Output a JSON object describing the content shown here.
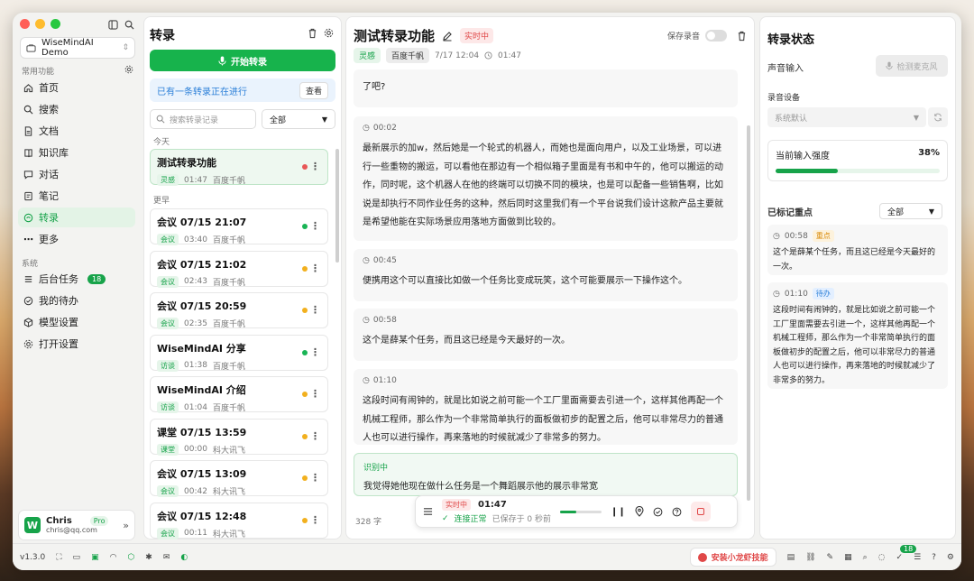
{
  "sidebar": {
    "workspace": "WiseMindAI Demo",
    "section_common": "常用功能",
    "items": [
      {
        "label": "首页",
        "icon": "home-icon"
      },
      {
        "label": "搜索",
        "icon": "search-icon"
      },
      {
        "label": "文档",
        "icon": "document-icon"
      },
      {
        "label": "知识库",
        "icon": "book-icon"
      },
      {
        "label": "对话",
        "icon": "chat-icon"
      },
      {
        "label": "笔记",
        "icon": "note-icon"
      },
      {
        "label": "转录",
        "icon": "transcribe-icon",
        "active": true
      },
      {
        "label": "更多",
        "icon": "more-icon"
      }
    ],
    "section_system": "系统",
    "system_items": [
      {
        "label": "后台任务",
        "badge": "18"
      },
      {
        "label": "我的待办"
      },
      {
        "label": "模型设置"
      },
      {
        "label": "打开设置"
      }
    ],
    "user": {
      "name": "Chris",
      "email": "chris@qq.com",
      "plan": "Pro",
      "initial": "W"
    }
  },
  "list": {
    "title": "转录",
    "start_label": "开始转录",
    "notice": "已有一条转录正在进行",
    "view_label": "查看",
    "search_placeholder": "搜索转录记录",
    "filter": "全部",
    "group_today": "今天",
    "group_earlier": "更早",
    "today": [
      {
        "title": "测试转录功能",
        "tag": "灵感",
        "duration": "01:47",
        "engine": "百度千帆",
        "status_color": "#e85757"
      }
    ],
    "earlier": [
      {
        "title": "会议 07/15 21:07",
        "tag": "会议",
        "duration": "03:40",
        "engine": "百度千帆",
        "status_color": "#19b455"
      },
      {
        "title": "会议 07/15 21:02",
        "tag": "会议",
        "duration": "02:43",
        "engine": "百度千帆",
        "status_color": "#f2b01e"
      },
      {
        "title": "会议 07/15 20:59",
        "tag": "会议",
        "duration": "02:35",
        "engine": "百度千帆",
        "status_color": "#f2b01e"
      },
      {
        "title": "WiseMindAI 分享",
        "tag": "访谈",
        "duration": "01:38",
        "engine": "百度千帆",
        "status_color": "#19b455"
      },
      {
        "title": "WiseMindAI 介绍",
        "tag": "访谈",
        "duration": "01:04",
        "engine": "百度千帆",
        "status_color": "#f2b01e"
      },
      {
        "title": "课堂 07/15 13:59",
        "tag": "课堂",
        "duration": "00:00",
        "engine": "科大讯飞",
        "status_color": "#f2b01e"
      },
      {
        "title": "会议 07/15 13:09",
        "tag": "会议",
        "duration": "00:42",
        "engine": "科大讯飞",
        "status_color": "#f2b01e"
      },
      {
        "title": "会议 07/15 12:48",
        "tag": "会议",
        "duration": "00:11",
        "engine": "科大讯飞",
        "status_color": "#f2b01e"
      }
    ]
  },
  "main": {
    "title": "测试转录功能",
    "live_label": "实时中",
    "tag": "灵感",
    "engine": "百度千帆",
    "date": "7/17 12:04",
    "duration": "01:47",
    "save_label": "保存录音",
    "top_fragment": "了吧?",
    "segments": [
      {
        "time": "00:02",
        "text": "最新展示的加w，然后她是一个轮式的机器人，而她也是面向用户，以及工业场景，可以进行一些重物的搬运，可以看他在那边有一个相似箱子里面是有书和中午的，他可以搬运的动作，同时呢，这个机器人在他的终端可以切换不同的模块，也是可以配备一些销售啊，比如说是却执行不同作业任务的这种，然后同时这里我们有一个平台说我们设计这款产品主要就是希望他能在实际场景应用落地方面做到比较的。"
      },
      {
        "time": "00:45",
        "text": "便携用这个可以直接比如做一个任务比变成玩笑，这个可能要展示一下操作这个。"
      },
      {
        "time": "00:58",
        "text": "这个是薛某个任务，而且这已经是今天最好的一次。"
      },
      {
        "time": "01:10",
        "text": "这段时间有闹钟的，就是比如说之前可能一个工厂里面需要去引进一个，这样其他再配一个机械工程师，那么作为一个非常简单执行的面板做初步的配置之后，他可以非常尽力的普通人也可以进行操作，再来落地的时候就减少了非常多的努力。"
      }
    ],
    "recognizing_label": "识别中",
    "recognizing_text": "我觉得她他现在做什么任务是一个舞蹈展示他的展示非常宽",
    "word_count": "328 字"
  },
  "player": {
    "live": "实时中",
    "time": "01:47",
    "connected": "连接正常",
    "saved": "已保存于 0 秒前",
    "progress": 0.4
  },
  "status": {
    "title": "转录状态",
    "audio_input": "声音输入",
    "detect_mic": "检测麦克风",
    "device_label": "录音设备",
    "device_value": "系统默认",
    "level_label": "当前输入强度",
    "level_value": "38%",
    "level": 0.38,
    "marked_label": "已标记重点",
    "marked_filter": "全部",
    "marks": [
      {
        "time": "00:58",
        "tag": "重点",
        "tag_type": "orange",
        "text": "这个是薛某个任务，而且这已经是今天最好的一次。"
      },
      {
        "time": "01:10",
        "tag": "待办",
        "tag_type": "blue",
        "text": "这段时间有闹钟的，就是比如说之前可能一个工厂里面需要去引进一个，这样其他再配一个机械工程师，那么作为一个非常简单执行的面板做初步的配置之后，他可以非常尽力的普通人也可以进行操作，再来落地的时候就减少了非常多的努力。"
      }
    ]
  },
  "bottom": {
    "version": "v1.3.0",
    "install_label": "安装小龙虾技能",
    "badge": "18"
  },
  "colors": {
    "accent": "#17a34a",
    "live": "#e04848",
    "brand": "#17b34c"
  }
}
